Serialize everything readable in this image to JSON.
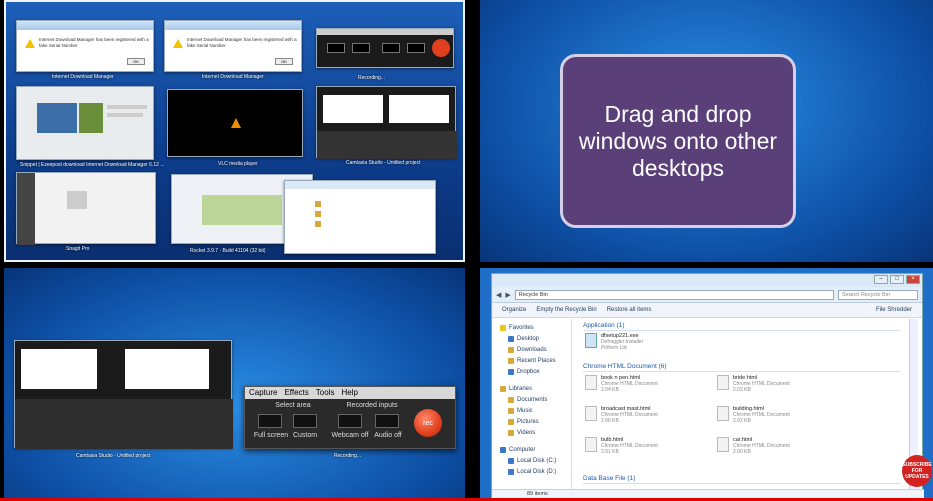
{
  "callout": {
    "text": "Drag and drop windows onto other desktops"
  },
  "desktop1": {
    "thumbs": [
      {
        "caption": "Internet Download Manager",
        "dialog_text": "Internet Download Manager has been registered with a fake Serial Number"
      },
      {
        "caption": "Internet Download Manager",
        "dialog_text": "Internet Download Manager has been registered with a fake Serial Number"
      },
      {
        "caption": "Recording..."
      },
      {
        "caption": "Snippet | Ezeepost download Internet Download Manager 6.12 ..."
      },
      {
        "caption": "VLC media player"
      },
      {
        "caption": "Camtasia Studio - Untitled project"
      },
      {
        "caption": "Snagit Pro"
      },
      {
        "caption": "Rocket 3.9.7 · Build 41104 (32 bit)"
      }
    ]
  },
  "camtasia": {
    "menu": [
      "Capture",
      "Effects",
      "Tools",
      "Help"
    ],
    "select_area_label": "Select area",
    "recorded_inputs_label": "Recorded inputs",
    "full_screen": "Full screen",
    "custom": "Custom",
    "webcam": "Webcam off",
    "audio": "Audio off",
    "rec": "rec"
  },
  "desktop3": {
    "caption1": "Camtasia Studio - Untitled project",
    "caption2": "Recording..."
  },
  "explorer": {
    "address": "Recycle Bin",
    "search_placeholder": "Search Recycle Bin",
    "toolbar": [
      "Organize",
      "Empty the Recycle Bin",
      "Restore all items"
    ],
    "toolbar_right": "File Shredder",
    "nav": [
      {
        "label": "Favorites",
        "level": 0
      },
      {
        "label": "Desktop",
        "level": 1
      },
      {
        "label": "Downloads",
        "level": 1
      },
      {
        "label": "Recent Places",
        "level": 1
      },
      {
        "label": "Dropbox",
        "level": 1
      },
      {
        "label": "Libraries",
        "level": 0
      },
      {
        "label": "Documents",
        "level": 1
      },
      {
        "label": "Music",
        "level": 1
      },
      {
        "label": "Pictures",
        "level": 1
      },
      {
        "label": "Videos",
        "level": 1
      },
      {
        "label": "Computer",
        "level": 0
      },
      {
        "label": "Local Disk (C:)",
        "level": 1
      },
      {
        "label": "Local Disk (D:)",
        "level": 1
      }
    ],
    "groups": [
      {
        "label": "Application (1)"
      },
      {
        "label": "Chrome HTML Document (6)"
      },
      {
        "label": "Data Base File (1)"
      }
    ],
    "app_file": {
      "name": "dfsetup221.exe",
      "sub1": "Defraggler Installer",
      "sub2": "Piriform Ltd"
    },
    "html_files": [
      {
        "name": "book n pen.html",
        "type": "Chrome HTML Document",
        "size": "2.04 KB"
      },
      {
        "name": "bride.html",
        "type": "Chrome HTML Document",
        "size": "2.03 KB"
      },
      {
        "name": "broadcast mast.html",
        "type": "Chrome HTML Document",
        "size": "2.06 KB"
      },
      {
        "name": "building.html",
        "type": "Chrome HTML Document",
        "size": "2.02 KB"
      },
      {
        "name": "bulb.html",
        "type": "Chrome HTML Document",
        "size": "2.01 KB"
      },
      {
        "name": "car.html",
        "type": "Chrome HTML Document",
        "size": "2.00 KB"
      }
    ],
    "status": "89 items"
  },
  "badge": {
    "text": "SUBSCRIBE FOR UPDATES"
  }
}
